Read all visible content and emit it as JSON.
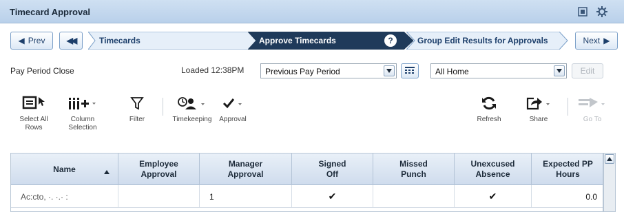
{
  "window": {
    "title": "Timecard Approval",
    "icons": [
      "restore-icon",
      "gear-icon"
    ]
  },
  "breadcrumb": {
    "prev_label": "Prev",
    "rewind_icon": "double-chevron-left-icon",
    "steps": [
      "Timecards",
      "Approve Timecards",
      "Group Edit Results for Approvals"
    ],
    "active_step": "Approve Timecards",
    "help_label": "?",
    "next_label": "Next"
  },
  "pay_period": {
    "label": "Pay Period Close",
    "loaded_text": "Loaded 12:38PM",
    "period_select": "Previous Pay Period",
    "location_select": "All Home",
    "edit_label": "Edit"
  },
  "toolbar": {
    "select_all_rows": "Select All Rows",
    "column_selection": "Column Selection",
    "filter": "Filter",
    "timekeeping": "Timekeeping",
    "approval": "Approval",
    "refresh": "Refresh",
    "share": "Share",
    "go_to": "Go To"
  },
  "grid": {
    "columns": [
      "Name",
      "Employee Approval",
      "Manager Approval",
      "Signed Off",
      "Missed Punch",
      "Unexcused Absence",
      "Expected PP Hours"
    ],
    "rows": [
      {
        "name": "Ac:cto, ·. ·.· :",
        "employee_approval": "",
        "manager_approval": "1",
        "signed_off": "✔",
        "missed_punch": "",
        "unexcused_absence": "✔",
        "expected_pp_hours": "0.0"
      }
    ]
  },
  "colors": {
    "accent": "#1f3a5a",
    "title_bar": "#c4d8ee",
    "button_border": "#7a9fc8"
  }
}
